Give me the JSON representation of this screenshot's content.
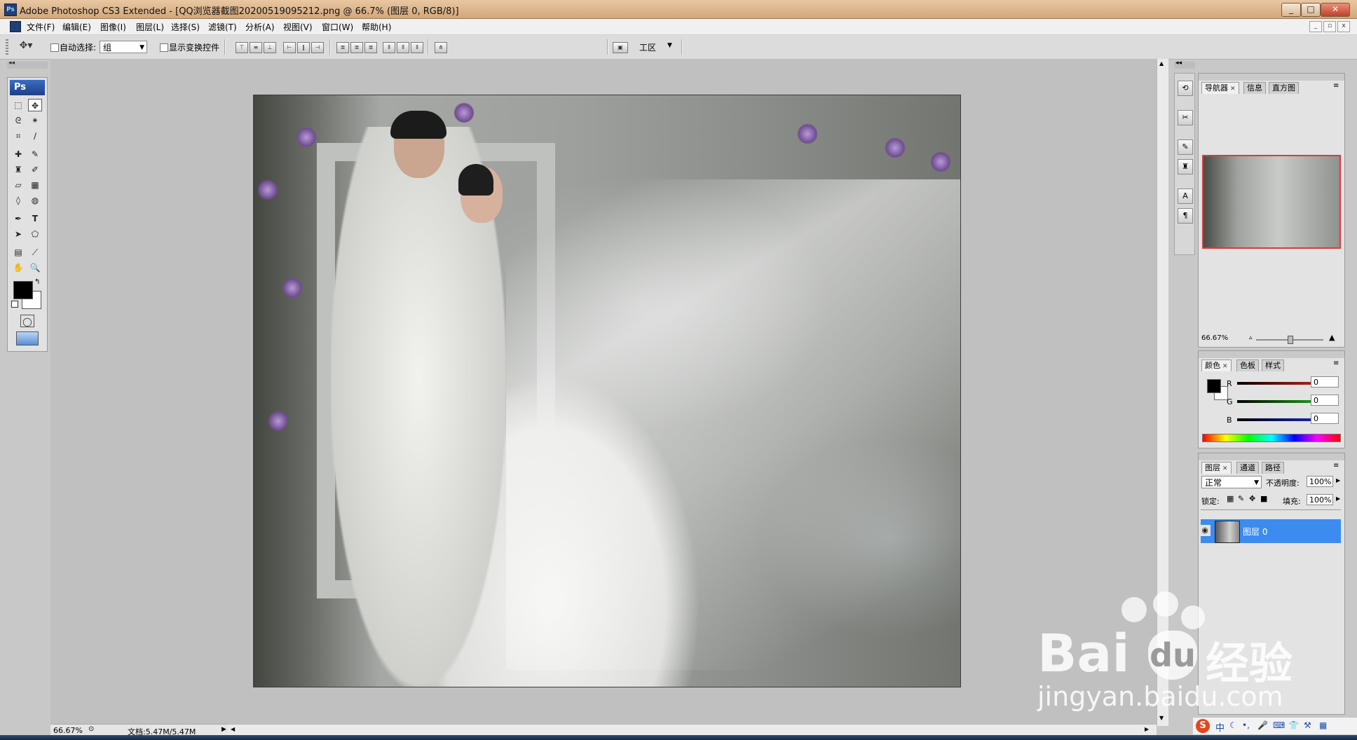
{
  "window": {
    "title": "Adobe Photoshop CS3 Extended - [QQ浏览器截图20200519095212.png @ 66.7% (图层 0, RGB/8)]",
    "min": "_",
    "max": "□",
    "close": "✕"
  },
  "menu": [
    "文件(F)",
    "编辑(E)",
    "图像(I)",
    "图层(L)",
    "选择(S)",
    "滤镜(T)",
    "分析(A)",
    "视图(V)",
    "窗口(W)",
    "帮助(H)"
  ],
  "options": {
    "auto_select_label": "自动选择:",
    "auto_select_value": "组",
    "show_transform_label": "显示变换控件",
    "workspace_label": "工区"
  },
  "tools": {
    "brand": "Ps"
  },
  "status": {
    "zoom": "66.67%",
    "doc": "文档:5.47M/5.47M"
  },
  "panels": {
    "navigator": {
      "tabs": [
        "导航器",
        "信息",
        "直方图"
      ],
      "zoom": "66.67%"
    },
    "color": {
      "tabs": [
        "颜色",
        "色板",
        "样式"
      ],
      "channels": [
        {
          "name": "R",
          "value": "0",
          "color": "#e0201a"
        },
        {
          "name": "G",
          "value": "0",
          "color": "#21b521"
        },
        {
          "name": "B",
          "value": "0",
          "color": "#1d2ad6"
        }
      ]
    },
    "layers": {
      "tabs": [
        "图层",
        "通道",
        "路径"
      ],
      "blend_mode": "正常",
      "opacity_label": "不透明度:",
      "opacity": "100%",
      "lock_label": "锁定:",
      "fill_label": "填充:",
      "fill": "100%",
      "layer_name": "图层 0"
    }
  },
  "watermark": {
    "brand_left": "Bai",
    "brand_right": "经验",
    "url": "jingyan.baidu.com"
  },
  "tray": {
    "ime": "中"
  },
  "colors": {
    "accent": "#3c8cf0",
    "title_bar": "#d8b088"
  }
}
